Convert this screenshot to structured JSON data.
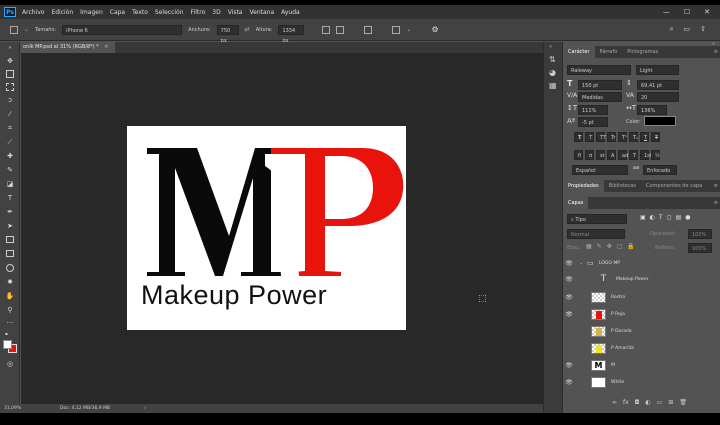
{
  "app": {
    "logo": "Ps"
  },
  "menu": [
    "Archivo",
    "Edición",
    "Imagen",
    "Capa",
    "Texto",
    "Selección",
    "Filtro",
    "3D",
    "Vista",
    "Ventana",
    "Ayuda"
  ],
  "options": {
    "size_label": "Tamaño:",
    "size_value": "iPhone 6",
    "width_label": "Anchura:",
    "width_value": "750 px",
    "height_label": "Altura:",
    "height_value": "1334 px"
  },
  "document": {
    "tab_title": "oník MP.psd al 31% (RGB/8*) *",
    "zoom": "31,09%",
    "doc_info": "Doc: 4,12 MB/36,9 MB"
  },
  "artwork": {
    "letters": "MP",
    "tagline": "Makeup Power",
    "colors": {
      "black": "#0a0a0a",
      "red": "#e8140c"
    }
  },
  "character_panel": {
    "tabs": [
      "Carácter",
      "Párrafo",
      "Pictogramas"
    ],
    "font_family": "Raleway",
    "font_style": "Light",
    "font_size": "150 pt",
    "leading": "69,41 pt",
    "kerning": "Medidas",
    "tracking": "20",
    "vscale": "111%",
    "hscale": "136%",
    "baseline": "-5 pt",
    "color_label": "Color:",
    "language": "Español",
    "antialias": "Enfocado",
    "style_buttons": [
      "T",
      "T",
      "TT",
      "Tr",
      "T¹",
      "T₁",
      "T",
      "T"
    ],
    "opentype_buttons": [
      "fi",
      "ơ",
      "st",
      "A",
      "ad",
      "T",
      "1st",
      "½"
    ]
  },
  "properties_tabs": [
    "Propiedades",
    "Bibliotecas",
    "Componentes de capa"
  ],
  "layers_panel": {
    "title": "Capas",
    "filter": "Tipo",
    "blend": "Normal",
    "opacity_label": "Opacidad:",
    "opacity": "100%",
    "lock_label": "Bloq.:",
    "fill_label": "Relleno:",
    "fill": "100%",
    "layers": [
      {
        "name": "LOGO MP",
        "kind": "group",
        "visible": true
      },
      {
        "name": "Makeup Power",
        "kind": "text",
        "visible": true
      },
      {
        "name": "Rostro",
        "kind": "raster",
        "visible": true
      },
      {
        "name": "P Roja",
        "kind": "raster",
        "visible": true
      },
      {
        "name": "P Dorada",
        "kind": "raster",
        "visible": false
      },
      {
        "name": "P Amarilla",
        "kind": "raster",
        "visible": false
      },
      {
        "name": "M",
        "kind": "raster",
        "visible": true
      },
      {
        "name": "White",
        "kind": "raster",
        "visible": true
      }
    ]
  }
}
